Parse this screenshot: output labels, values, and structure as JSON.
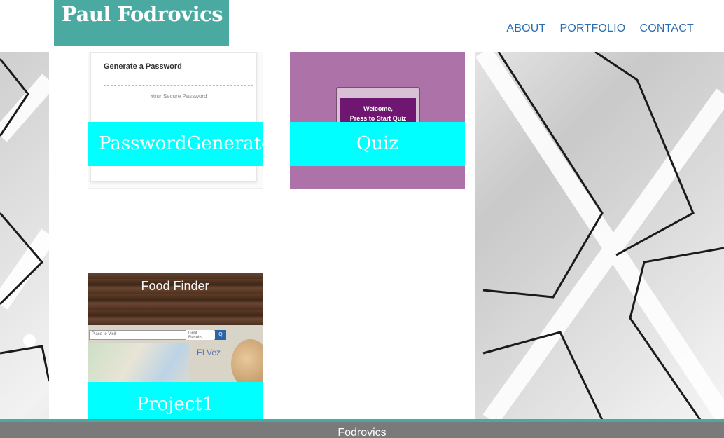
{
  "header": {
    "brand": "Paul Fodrovics",
    "nav": [
      {
        "label": "ABOUT"
      },
      {
        "label": "PORTFOLIO"
      },
      {
        "label": "CONTACT"
      }
    ]
  },
  "portfolio": {
    "cards": [
      {
        "label": "PasswordGenerator",
        "preview": {
          "title": "Generate a Password",
          "hint": "Your Secure Password"
        }
      },
      {
        "label": "Quiz",
        "preview": {
          "line1": "Welcome,",
          "line2": "Press to Start Quiz"
        }
      },
      {
        "label": "Project1",
        "preview": {
          "title": "Food Finder",
          "search_placeholder": "Place to Visit",
          "search_placeholder2": "Limit Results",
          "button": "Q",
          "place_name": "El Vez"
        }
      }
    ]
  },
  "footer": {
    "text": "Fodrovics"
  },
  "colors": {
    "brand": "#4aa9a0",
    "nav": "#2a6db0",
    "card_label": "#00ffff",
    "footer": "#7a7a7a"
  }
}
